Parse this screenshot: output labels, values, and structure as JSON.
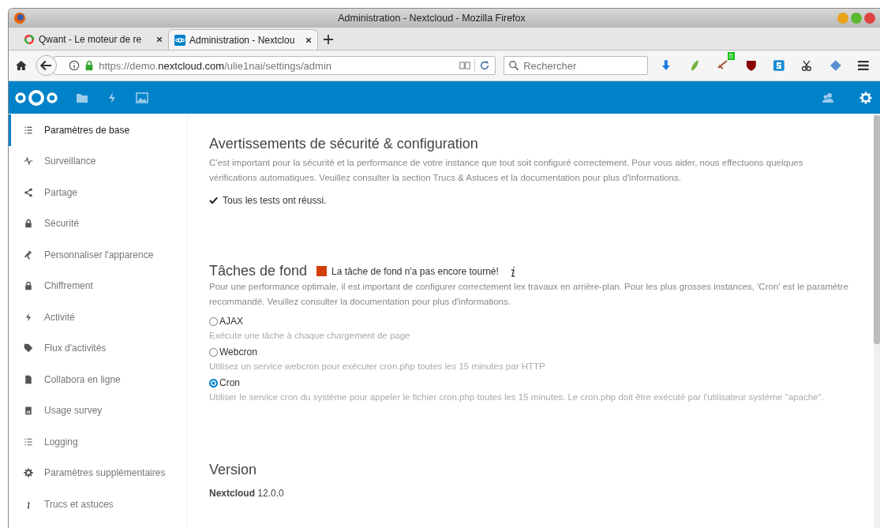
{
  "window": {
    "title": "Administration - Nextcloud - Mozilla Firefox"
  },
  "tabs": [
    {
      "label": "Qwant - Le moteur de re",
      "selected": false
    },
    {
      "label": "Administration - Nextclou",
      "selected": true
    }
  ],
  "address_bar": {
    "url_prefix": "https://demo.",
    "url_domain": "nextcloud.com",
    "url_path": "/ulie1nai/settings/admin"
  },
  "search": {
    "placeholder": "Rechercher"
  },
  "extension_badge": "0",
  "sidebar": {
    "items": [
      {
        "label": "Paramètres de base",
        "selected": true
      },
      {
        "label": "Surveillance",
        "selected": false
      },
      {
        "label": "Partage",
        "selected": false
      },
      {
        "label": "Sécurité",
        "selected": false
      },
      {
        "label": "Personnaliser l'apparence",
        "selected": false
      },
      {
        "label": "Chiffrement",
        "selected": false
      },
      {
        "label": "Activité",
        "selected": false
      },
      {
        "label": "Flux d'activités",
        "selected": false
      },
      {
        "label": "Collabora en ligne",
        "selected": false
      },
      {
        "label": "Usage survey",
        "selected": false
      },
      {
        "label": "Logging",
        "selected": false
      },
      {
        "label": "Paramètres supplémentaires",
        "selected": false
      },
      {
        "label": "Trucs et astuces",
        "selected": false
      }
    ]
  },
  "security": {
    "title": "Avertissements de sécurité & configuration",
    "description": "C'est important pour la sécurité et la performance de votre instance que tout soit configuré correctement. Pour vous aider, nous effectuons quelques vérifications automatiques. Veuillez consulter la section Trucs & Astuces et la documentation pour plus d'informations.",
    "status": "Tous les tests ont réussi."
  },
  "background_jobs": {
    "title": "Tâches de fond",
    "warning": "La tâche de fond n'a pas encore tourné!",
    "description": "Pour une performance optimale, il est important de configurer correctement lex travaux en arrière-plan. Pour les plus grosses instances, 'Cron' est le paramètre recommandé. Veuillez consulter la documentation pour plus d'informations.",
    "options": [
      {
        "label": "AJAX",
        "hint": "Exécute une tâche à chaque chargement de page",
        "selected": false
      },
      {
        "label": "Webcron",
        "hint": "Utilisez un service webcron pour exécuter cron.php toutes les 15 minutes par HTTP",
        "selected": false
      },
      {
        "label": "Cron",
        "hint": "Utiliser le service cron du système pour appeler le fichier cron.php toutes les 15 minutes. Le cron.php doit être exécuté par l'utilisateur système \"apache\".",
        "selected": true
      }
    ]
  },
  "version": {
    "title": "Version",
    "text": "**Nextcloud** 12.0.0"
  }
}
